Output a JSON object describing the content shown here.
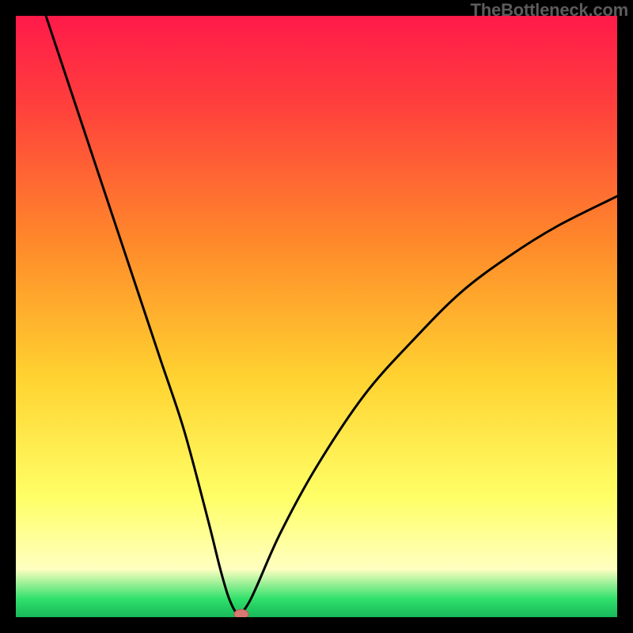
{
  "watermark": "TheBottleneck.com",
  "colors": {
    "frame": "#000000",
    "grad_top": "#ff1a4a",
    "grad_mid_red": "#ff3d3d",
    "grad_mid_orange": "#ff8a2a",
    "grad_mid_yellow": "#ffd230",
    "grad_low_yellow": "#ffff66",
    "grad_cream": "#ffffc0",
    "grad_green": "#2fe06a",
    "grad_green_dark": "#18b85a",
    "curve": "#000000",
    "marker_fill": "#d97a72",
    "marker_stroke": "#b95a54"
  },
  "chart_data": {
    "type": "line",
    "title": "",
    "xlabel": "",
    "ylabel": "",
    "xlim": [
      0,
      100
    ],
    "ylim": [
      0,
      100
    ],
    "grid": false,
    "axes_visible": false,
    "description": "Bottleneck curve: value drops from ~100 at x≈5 to ~0 at x≈37 (minimum), then rises concavely to ~70 at x=100.",
    "series": [
      {
        "name": "bottleneck-curve",
        "x": [
          5,
          8,
          12,
          16,
          20,
          24,
          28,
          32,
          34,
          35.5,
          37,
          38.5,
          40,
          44,
          50,
          58,
          66,
          74,
          82,
          90,
          100
        ],
        "y": [
          100,
          91,
          79,
          67,
          55,
          43,
          31,
          16,
          8,
          3,
          0.5,
          2,
          5,
          14,
          25,
          37,
          46,
          54,
          60,
          65,
          70
        ]
      }
    ],
    "marker": {
      "x": 37.5,
      "y": 0.5
    }
  }
}
